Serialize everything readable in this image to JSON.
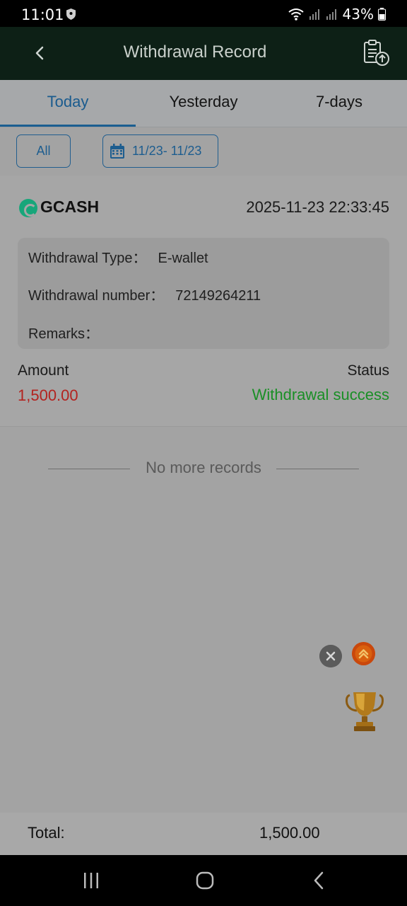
{
  "status_bar": {
    "time": "11:01",
    "battery": "43%"
  },
  "header": {
    "title": "Withdrawal Record"
  },
  "tabs": [
    {
      "label": "Today",
      "active": true
    },
    {
      "label": "Yesterday",
      "active": false
    },
    {
      "label": "7-days",
      "active": false
    }
  ],
  "filters": {
    "all_label": "All",
    "date_range": "11/23- 11/23"
  },
  "record": {
    "method": "GCASH",
    "datetime": "2025-11-23 22:33:45",
    "withdrawal_type_label": "Withdrawal Type：",
    "withdrawal_type_value": "E-wallet",
    "withdrawal_number_label": "Withdrawal number：",
    "withdrawal_number_value": "72149264211",
    "remarks_label": "Remarks：",
    "remarks_value": "",
    "amount_label": "Amount",
    "amount_value": "1,500.00",
    "status_label": "Status",
    "status_value": "Withdrawal success"
  },
  "list_end_text": "No more records",
  "footer": {
    "total_label": "Total:",
    "total_value": "1,500.00"
  },
  "icons": {
    "back": "chevron-left-icon",
    "upload": "clipboard-upload-icon",
    "calendar": "calendar-icon",
    "close": "close-icon",
    "scroll_top": "double-chevron-up-icon",
    "trophy": "trophy-icon"
  },
  "colors": {
    "header_bg": "#0d2016",
    "accent": "#1b5e91",
    "amount": "#b3231f",
    "success": "#1a8f26"
  }
}
